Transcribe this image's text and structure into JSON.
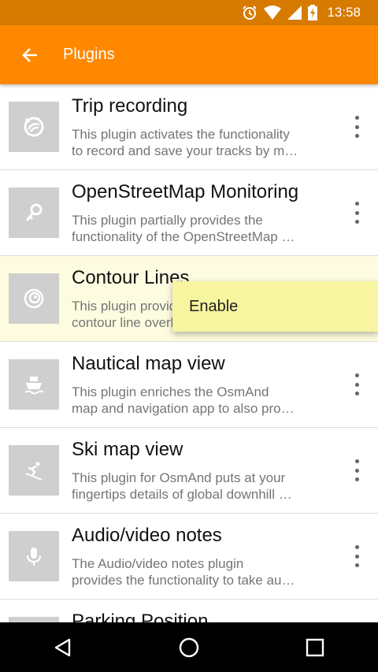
{
  "status_bar": {
    "time": "13:58",
    "icons": [
      "alarm-icon",
      "wifi-icon",
      "signal-icon",
      "battery-charging-icon"
    ]
  },
  "app_bar": {
    "title": "Plugins",
    "back_icon": "arrow-back-icon"
  },
  "plugins": [
    {
      "title": "Trip recording",
      "desc_line1": "This plugin activates the functionality",
      "desc_line2": "to record and save your tracks by m…",
      "icon": "trip-recording-icon"
    },
    {
      "title": "OpenStreetMap Monitoring",
      "desc_line1": "This plugin partially provides the",
      "desc_line2": "functionality of the OpenStreetMap …",
      "icon": "osm-monitoring-icon"
    },
    {
      "title": "Contour Lines",
      "desc_line1": "This plugin provides",
      "desc_line2": "contour line overlay",
      "icon": "contour-lines-icon"
    },
    {
      "title": "Nautical map view",
      "desc_line1": "This plugin enriches the OsmAnd",
      "desc_line2": "map and navigation app to also pro…",
      "icon": "ship-icon"
    },
    {
      "title": "Ski map view",
      "desc_line1": "This plugin for OsmAnd puts at your",
      "desc_line2": "fingertips details of global downhill …",
      "icon": "skier-icon"
    },
    {
      "title": "Audio/video notes",
      "desc_line1": "The Audio/video notes plugin",
      "desc_line2": "provides the functionality to take au…",
      "icon": "microphone-icon"
    },
    {
      "title": "Parking Position",
      "desc_line1": "",
      "desc_line2": "",
      "icon": "parking-icon"
    }
  ],
  "popup_menu": {
    "enable_label": "Enable"
  },
  "nav_bar": {
    "back": "nav-back-icon",
    "home": "nav-home-icon",
    "recents": "nav-recents-icon"
  },
  "colors": {
    "status_bar": "#d67a00",
    "app_bar": "#ff8800",
    "highlight_row": "#fdfce0",
    "popup": "#f7f59f"
  }
}
